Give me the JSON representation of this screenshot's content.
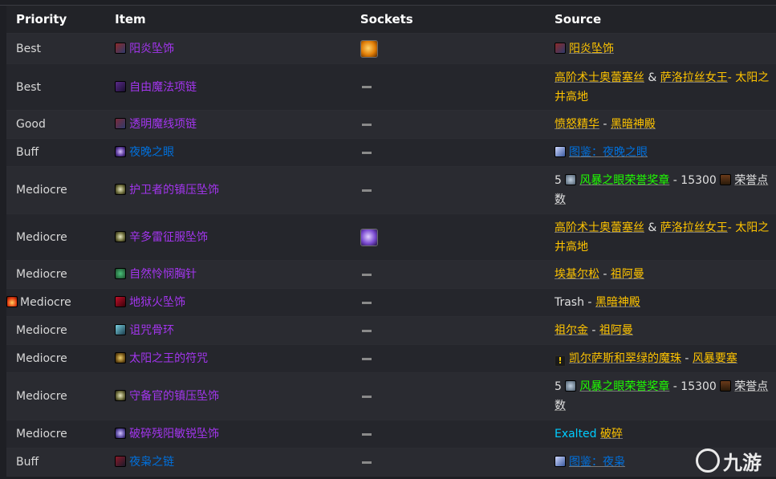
{
  "headers": {
    "priority": "Priority",
    "item": "Item",
    "sockets": "Sockets",
    "source": "Source"
  },
  "rows": [
    {
      "priority": "Best",
      "item": "阳炎坠饰",
      "item_icon": "sunfire-pendant-icon",
      "socket": "orange-gem",
      "source_pre": "",
      "source_a": "阳炎坠饰",
      "source_mid": "",
      "source_b": "",
      "source_post": ""
    },
    {
      "priority": "Best",
      "item": "自由魔法项链",
      "item_icon": "purple-necklace-icon",
      "socket": "none",
      "source_pre": "",
      "source_a": "高阶术士奥蕾塞丝",
      "source_mid": " & ",
      "source_b": "萨洛拉丝女王",
      "source_post": "- 太阳之井高地"
    },
    {
      "priority": "Good",
      "item": "透明魔线项链",
      "item_icon": "necklace-icon",
      "socket": "none",
      "source_pre": "",
      "source_a": "愤怒精华",
      "source_mid": " - ",
      "source_b": "黑暗神殿",
      "source_post": ""
    },
    {
      "priority": "Buff",
      "item": "夜晚之眼",
      "item_icon": "eye-icon",
      "socket": "none",
      "source_pre": "",
      "source_a": "图鉴：夜晚之眼",
      "source_mid": "",
      "source_b": "",
      "source_post": ""
    },
    {
      "priority": "Mediocre",
      "item": "护卫者的镇压坠饰",
      "item_icon": "pendant-icon",
      "socket": "none",
      "source_pre": "5 ",
      "source_a": "风暴之眼荣誉奖章",
      "source_mid": " - 15300 ",
      "source_b": "荣誉点数",
      "source_post": ""
    },
    {
      "priority": "Mediocre",
      "item": "辛多雷征服坠饰",
      "item_icon": "pendant-icon",
      "socket": "purple-gem",
      "source_pre": "",
      "source_a": "高阶术士奥蕾塞丝",
      "source_mid": " & ",
      "source_b": "萨洛拉丝女王",
      "source_post": "- 太阳之井高地"
    },
    {
      "priority": "Mediocre",
      "item": "自然怜悯胸针",
      "item_icon": "brooch-icon",
      "socket": "none",
      "source_pre": "",
      "source_a": "埃基尔松",
      "source_mid": " - ",
      "source_b": "祖阿曼",
      "source_post": ""
    },
    {
      "priority": "Mediocre",
      "item": "地狱火坠饰",
      "item_icon": "hellfire-pendant-icon",
      "socket": "none",
      "source_pre": "Trash - ",
      "source_a": "",
      "source_mid": "",
      "source_b": "黑暗神殿",
      "source_post": "",
      "priority_icon": "fire-icon"
    },
    {
      "priority": "Mediocre",
      "item": "诅咒骨环",
      "item_icon": "bone-collar-icon",
      "socket": "none",
      "source_pre": "",
      "source_a": "祖尔金",
      "source_mid": " - ",
      "source_b": "祖阿曼",
      "source_post": ""
    },
    {
      "priority": "Mediocre",
      "item": "太阳之王的符咒",
      "item_icon": "talisman-icon",
      "socket": "none",
      "source_pre": "",
      "source_a": "凯尔萨斯和翠绿的魔珠",
      "source_mid": " - ",
      "source_b": "风暴要塞",
      "source_post": ""
    },
    {
      "priority": "Mediocre",
      "item": "守备官的镇压坠饰",
      "item_icon": "pendant-icon",
      "socket": "none",
      "source_pre": "5 ",
      "source_a": "风暴之眼荣誉奖章",
      "source_mid": " - 15300 ",
      "source_b": "荣誉点数",
      "source_post": ""
    },
    {
      "priority": "Mediocre",
      "item": "破碎残阳敏锐坠饰",
      "item_icon": "shattered-sun-pendant-icon",
      "socket": "none",
      "source_pre": "",
      "source_a": "Exalted",
      "source_mid": " ",
      "source_b": "破碎",
      "source_post": ""
    },
    {
      "priority": "Buff",
      "item": "夜枭之链",
      "item_icon": "chain-icon",
      "socket": "none",
      "source_pre": "",
      "source_a": "图鉴：夜枭",
      "source_mid": "",
      "source_b": "",
      "source_post": ""
    }
  ],
  "watermark": {
    "text": "九游"
  },
  "colors": {
    "epic": "#a335ee",
    "rare": "#0070dd",
    "npc": "#ffc400",
    "uncommon": "#1eff00",
    "exalted": "#00ccff"
  }
}
